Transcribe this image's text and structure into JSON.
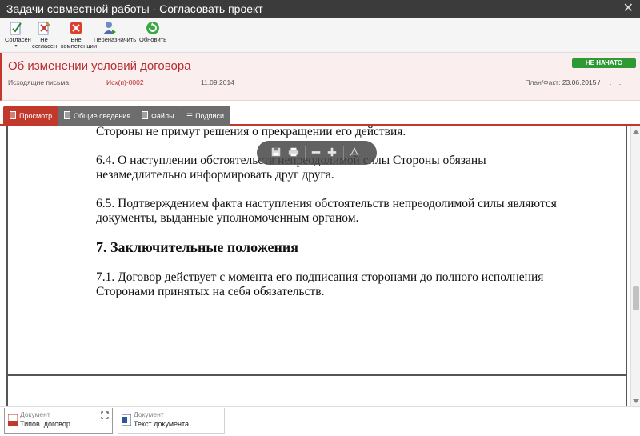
{
  "window": {
    "title": "Задачи совместной работы - Согласовать проект"
  },
  "toolbar": {
    "agree_label": "Согласен",
    "disagree_label": "Не согласен",
    "out_of_scope_label": "Вне компетенции",
    "reassign_label": "Переназначить",
    "refresh_label": "Обновить"
  },
  "header": {
    "title": "Об изменении условий договора",
    "category": "Исходящие письма",
    "number": "Исх(п)-0002",
    "date": "11.09.2014",
    "status": "НЕ НАЧАТО",
    "planfact_label": "План/Факт:",
    "planfact_value": "23.06.2015 / __.__.____",
    "colors": {
      "accent": "#c0392b",
      "status": "#2e9a34"
    }
  },
  "tabs": [
    {
      "label": "Просмотр",
      "icon": "document-icon",
      "active": true
    },
    {
      "label": "Общие сведения",
      "icon": "info-card-icon",
      "active": false
    },
    {
      "label": "Файлы",
      "icon": "file-icon",
      "active": false
    },
    {
      "label": "Подписи",
      "icon": "list-icon",
      "active": false
    }
  ],
  "document": {
    "line1": "Стороны не примут решения о прекращении его действия.",
    "p64": "6.4. О наступлении обстоятельств непреодолимой силы Стороны обязаны незамедлительно информировать друг друга.",
    "p65": "6.5. Подтверждением факта наступления обстоятельств непреодолимой силы являются документы, выданные уполномоченным органом.",
    "h7": "7. Заключительные положения",
    "p71": "7.1. Договор действует с момента его подписания сторонами до полного исполнения Сторонами принятых на себя обязательств."
  },
  "viewer_tools": [
    "save-icon",
    "print-icon",
    "zoom-out-icon",
    "zoom-in-icon",
    "pdf-icon"
  ],
  "attachments": [
    {
      "type_label": "Документ",
      "name": "Типов. договор",
      "icon": "pdf-icon",
      "active": true
    },
    {
      "type_label": "Документ",
      "name": "Текст документа",
      "icon": "word-icon",
      "active": false
    }
  ]
}
